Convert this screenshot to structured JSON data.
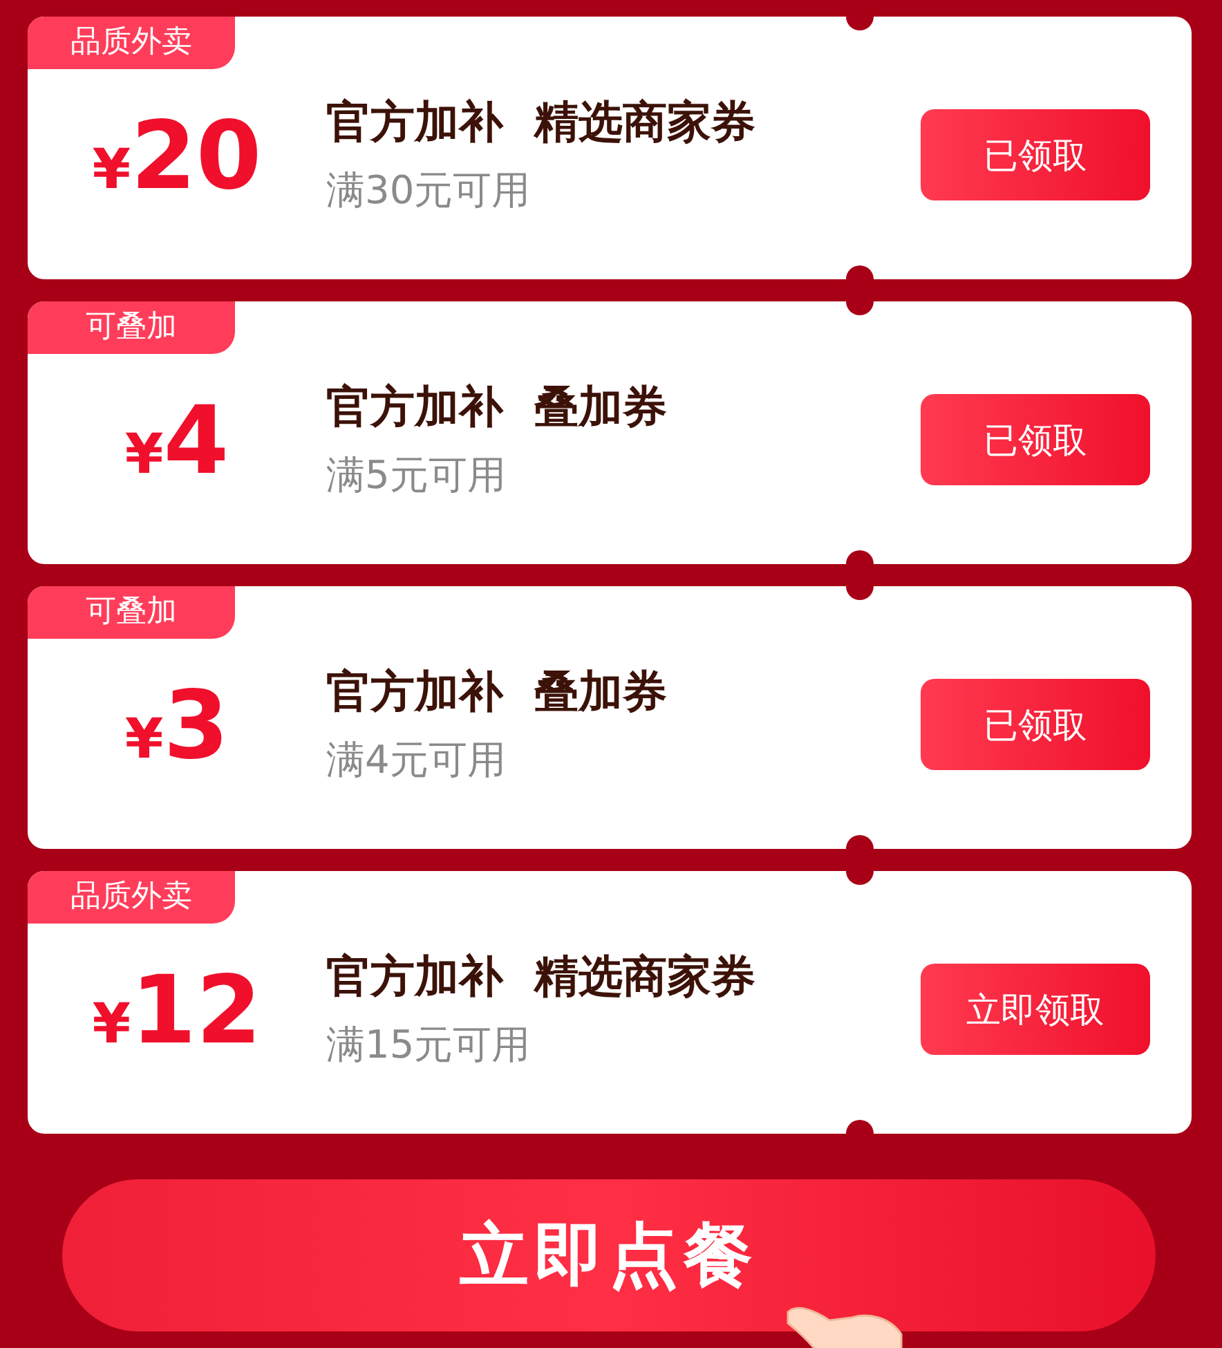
{
  "coupons": [
    {
      "tag": "品质外卖",
      "currency": "¥",
      "amount": "20",
      "title": "官方加补  精选商家券",
      "condition": "满30元可用",
      "button": "已领取"
    },
    {
      "tag": "可叠加",
      "currency": "¥",
      "amount": "4",
      "title": "官方加补  叠加券",
      "condition": "满5元可用",
      "button": "已领取"
    },
    {
      "tag": "可叠加",
      "currency": "¥",
      "amount": "3",
      "title": "官方加补  叠加券",
      "condition": "满4元可用",
      "button": "已领取"
    },
    {
      "tag": "品质外卖",
      "currency": "¥",
      "amount": "12",
      "title": "官方加补  精选商家券",
      "condition": "满15元可用",
      "button": "立即领取"
    }
  ],
  "order_button": "立即点餐"
}
